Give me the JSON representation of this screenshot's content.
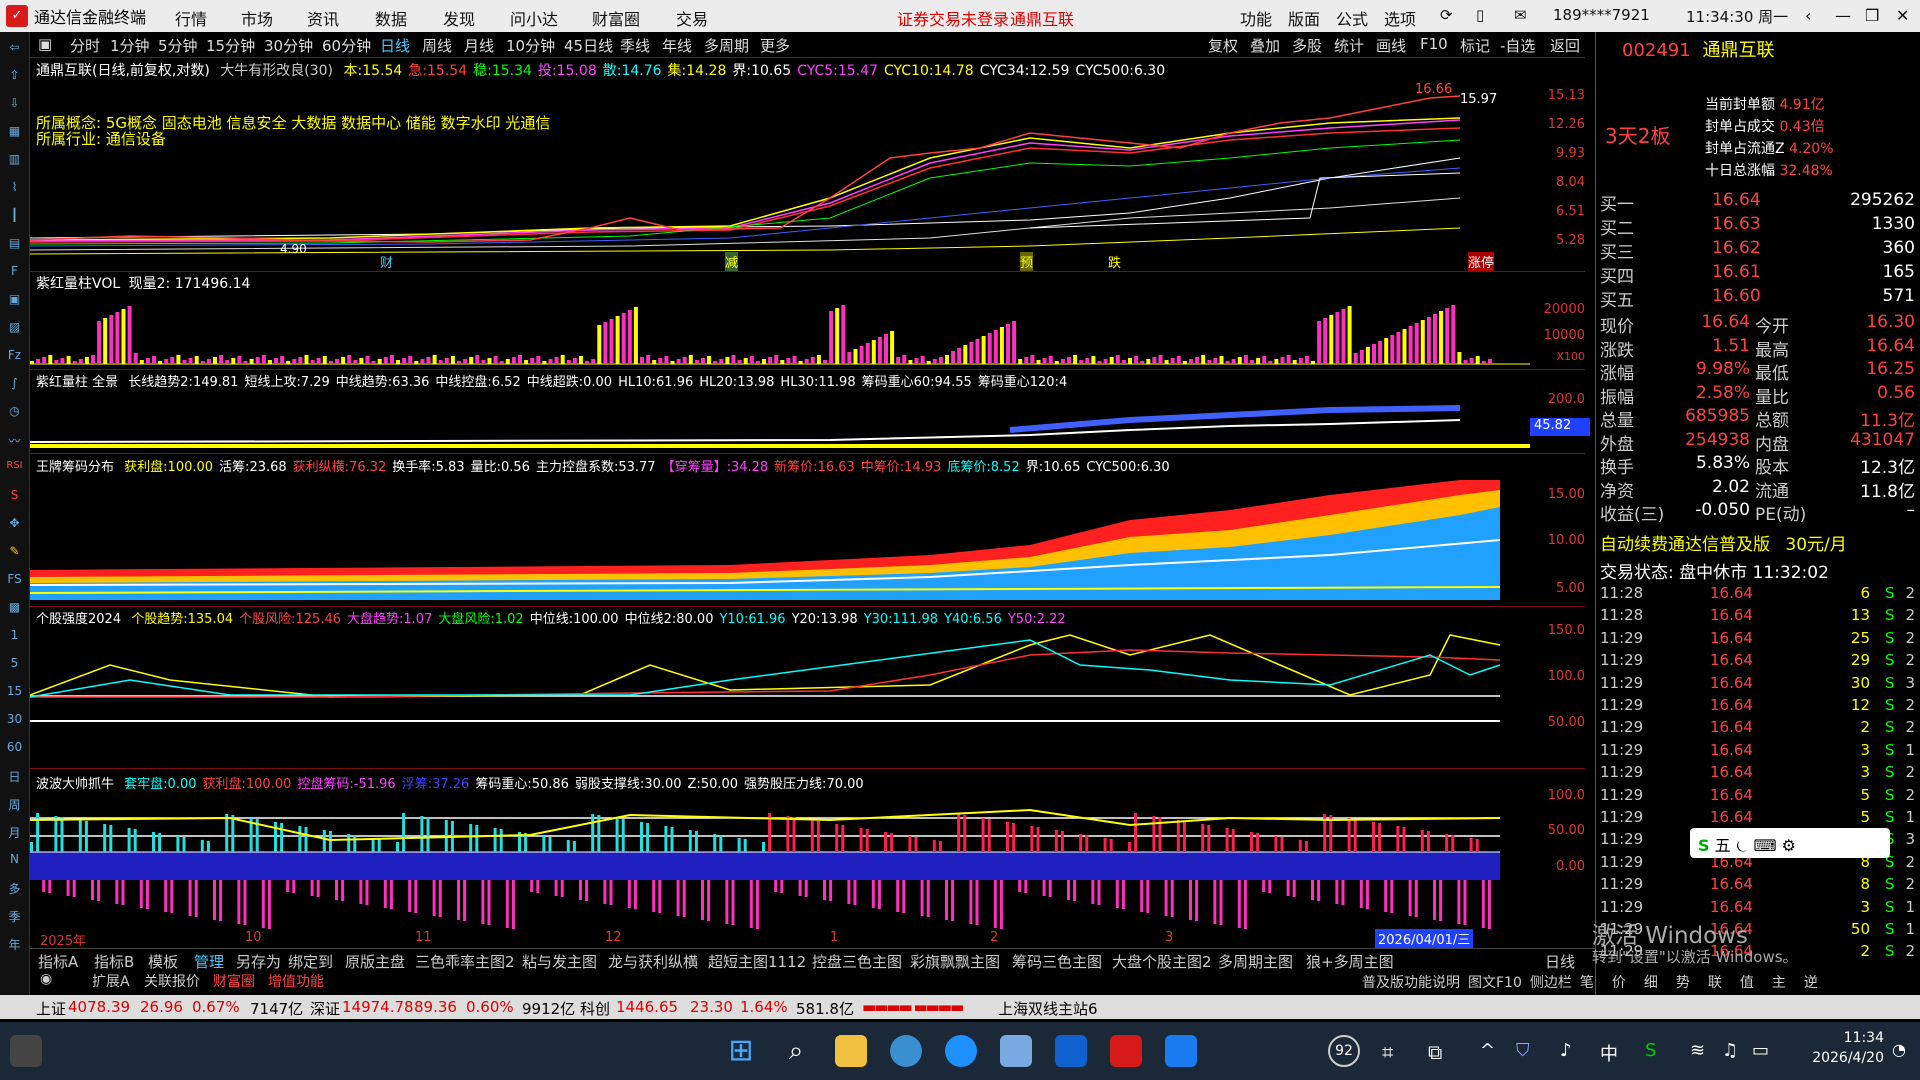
{
  "titlebar": {
    "app_name": "通达信金融终端",
    "menus": [
      "行情",
      "市场",
      "资讯",
      "数据",
      "发现",
      "问小达",
      "财富圈",
      "交易"
    ],
    "alert": "证券交易未登录",
    "stock_name": "通鼎互联",
    "right_menus": [
      "功能",
      "版面",
      "公式",
      "选项"
    ],
    "account": "189****7921",
    "clock": "11:34:30 周一"
  },
  "period_toolbar": {
    "items": [
      "分时",
      "1分钟",
      "5分钟",
      "15分钟",
      "30分钟",
      "60分钟",
      "日线",
      "周线",
      "月线",
      "10分钟",
      "45日线",
      "季线",
      "年线",
      "多周期",
      "更多"
    ],
    "right": [
      "复权",
      "叠加",
      "多股",
      "统计",
      "画线",
      "F10",
      "标记",
      "-自选",
      "返回"
    ]
  },
  "main_chart": {
    "header": "通鼎互联(日线,前复权,对数)",
    "indicator": "大牛有形改良(30)",
    "params": [
      {
        "k": "本:",
        "v": "15.54",
        "c": "#ffff00"
      },
      {
        "k": "急:",
        "v": "15.54",
        "c": "#ff4040"
      },
      {
        "k": "稳:",
        "v": "15.34",
        "c": "#00ff00"
      },
      {
        "k": "投:",
        "v": "15.08",
        "c": "#ff40ff"
      },
      {
        "k": "散:",
        "v": "14.76",
        "c": "#00ffff"
      },
      {
        "k": "集:",
        "v": "14.28",
        "c": "#ffff00"
      },
      {
        "k": "界:",
        "v": "10.65",
        "c": "#fff"
      },
      {
        "k": "CYC5:",
        "v": "15.47",
        "c": "#ff40ff"
      },
      {
        "k": "CYC10:",
        "v": "14.78",
        "c": "#ffff00"
      },
      {
        "k": "CYC34:",
        "v": "12.59",
        "c": "#fff"
      },
      {
        "k": "CYC500:",
        "v": "6.30",
        "c": "#fff"
      }
    ],
    "concept_label": "所属概念:",
    "concepts": "5G概念 固态电池 信息安全 大数据 数据中心 储能 数字水印 光通信",
    "industry_label": "所属行业:",
    "industry": "通信设备",
    "high_label": "16.66",
    "close_label": "15.97",
    "low_label": "4.90",
    "markers": [
      "财",
      "减",
      "预",
      "跌",
      "涨停"
    ],
    "y_ticks": [
      "15.13",
      "12.26",
      "9.93",
      "8.04",
      "6.51",
      "5.28"
    ]
  },
  "vol_panel": {
    "title": "紫红量柱VOL",
    "now_label": "现量2:",
    "now_value": "171496.14",
    "y_ticks": [
      "20000",
      "10000",
      "X100"
    ]
  },
  "trend_panel": {
    "title": "紫红量柱 全景",
    "items": [
      {
        "k": "长线趋势2:",
        "v": "149.81"
      },
      {
        "k": "短线上攻:",
        "v": "7.29"
      },
      {
        "k": "中线趋势:",
        "v": "63.36"
      },
      {
        "k": "中线控盘:",
        "v": "6.52"
      },
      {
        "k": "中线超跌:",
        "v": "0.00"
      },
      {
        "k": "HL10:",
        "v": "61.96"
      },
      {
        "k": "HL20:",
        "v": "13.98"
      },
      {
        "k": "HL30:",
        "v": "11.98"
      },
      {
        "k": "筹码重心60:",
        "v": "94.55"
      },
      {
        "k": "筹码重心120:",
        "v": "4"
      }
    ],
    "y_tick": "200.0",
    "current": "45.82"
  },
  "chip_panel": {
    "title": "王牌筹码分布",
    "items": [
      {
        "k": "获利盘:",
        "v": "100.00",
        "c": "#ffff00"
      },
      {
        "k": "活筹:",
        "v": "23.68",
        "c": "#fff"
      },
      {
        "k": "获利纵横:",
        "v": "76.32",
        "c": "#ff4040"
      },
      {
        "k": "换手率:",
        "v": "5.83",
        "c": "#fff"
      },
      {
        "k": "量比:",
        "v": "0.56",
        "c": "#fff"
      },
      {
        "k": "主力控盘系数:",
        "v": "53.77",
        "c": "#fff"
      },
      {
        "k": "【穿筹量】:",
        "v": "34.28",
        "c": "#ff40ff"
      },
      {
        "k": "新筹价:",
        "v": "16.63",
        "c": "#ff4040"
      },
      {
        "k": "中筹价:",
        "v": "14.93",
        "c": "#ff4040"
      },
      {
        "k": "底筹价:",
        "v": "8.52",
        "c": "#00ffff"
      },
      {
        "k": "界:",
        "v": "10.65",
        "c": "#fff"
      },
      {
        "k": "CYC500:",
        "v": "6.30",
        "c": "#fff"
      }
    ],
    "y_ticks": [
      "15.00",
      "10.00",
      "5.00"
    ]
  },
  "strength_panel": {
    "title": "个股强度2024",
    "items": [
      {
        "k": "个股趋势:",
        "v": "135.04",
        "c": "#ffff00"
      },
      {
        "k": "个股风险:",
        "v": "125.46",
        "c": "#ff4040"
      },
      {
        "k": "大盘趋势:",
        "v": "1.07",
        "c": "#ff40ff"
      },
      {
        "k": "大盘风险:",
        "v": "1.02",
        "c": "#00ff00"
      },
      {
        "k": "中位线:",
        "v": "100.00",
        "c": "#fff"
      },
      {
        "k": "中位线2:",
        "v": "80.00",
        "c": "#fff"
      },
      {
        "k": "Y10:",
        "v": "61.96",
        "c": "#00ffff"
      },
      {
        "k": "Y20:",
        "v": "13.98",
        "c": "#fff"
      },
      {
        "k": "Y30:",
        "v": "111.98",
        "c": "#00ffff"
      },
      {
        "k": "Y40:",
        "v": "6.56",
        "c": "#00ffff"
      },
      {
        "k": "Y50:",
        "v": "2.22",
        "c": "#ff40ff"
      }
    ],
    "y_ticks": [
      "150.0",
      "100.0",
      "50.00"
    ]
  },
  "wave_panel": {
    "title": "波波大帅抓牛",
    "items": [
      {
        "k": "套牢盘:",
        "v": "0.00",
        "c": "#00ffff"
      },
      {
        "k": "获利盘:",
        "v": "100.00",
        "c": "#ff4040"
      },
      {
        "k": "控盘筹码:",
        "v": "-51.96",
        "c": "#ff40ff"
      },
      {
        "k": "浮筹:",
        "v": "37.26",
        "c": "#4040ff"
      },
      {
        "k": "筹码重心:",
        "v": "50.86",
        "c": "#fff"
      },
      {
        "k": "弱股支撑线:",
        "v": "30.00",
        "c": "#fff"
      },
      {
        "k": "Z:",
        "v": "50.00",
        "c": "#fff"
      },
      {
        "k": "强势股压力线:",
        "v": "70.00",
        "c": "#fff"
      }
    ],
    "y_ticks": [
      "100.0",
      "50.00",
      "0.00"
    ],
    "date_start": "2025年",
    "date_cursor": "2026/04/01/三",
    "x_ticks": [
      "10",
      "11",
      "12",
      "1",
      "2",
      "3"
    ]
  },
  "bottom_tabs": [
    "指标A",
    "指标B",
    "模板",
    "管理",
    "另存为",
    "绑定到",
    "原版主盘",
    "三色乖率主图2",
    "粘与发主图",
    "龙与获利纵横",
    "超短主图1112",
    "控盘三色主图",
    "彩旗飘飘主图",
    "筹码三色主图",
    "大盘个股主图2",
    "多周期主图",
    "狼+多周主图"
  ],
  "bottom_tabs2": [
    "扩展A",
    "关联报价",
    "财富圈",
    "增值功能"
  ],
  "period_label": "日线",
  "right_panel": {
    "code": "002491",
    "name": "通鼎互联",
    "limit_tag": "3天2板",
    "seal": [
      {
        "k": "当前封单额",
        "v": "4.91亿"
      },
      {
        "k": "封单占成交",
        "v": "0.43倍"
      },
      {
        "k": "封单占流通Z",
        "v": "4.20%"
      },
      {
        "k": "十日总涨幅",
        "v": "32.48%"
      }
    ],
    "bids": [
      {
        "k": "买一",
        "p": "16.64",
        "v": "295262"
      },
      {
        "k": "买二",
        "p": "16.63",
        "v": "1330"
      },
      {
        "k": "买三",
        "p": "16.62",
        "v": "360"
      },
      {
        "k": "买四",
        "p": "16.61",
        "v": "165"
      },
      {
        "k": "买五",
        "p": "16.60",
        "v": "571"
      }
    ],
    "quotes": [
      {
        "a": "现价",
        "av": "16.64",
        "b": "今开",
        "bv": "16.30"
      },
      {
        "a": "涨跌",
        "av": "1.51",
        "b": "最高",
        "bv": "16.64"
      },
      {
        "a": "涨幅",
        "av": "9.98%",
        "b": "最低",
        "bv": "16.25"
      },
      {
        "a": "振幅",
        "av": "2.58%",
        "b": "量比",
        "bv": "0.56"
      },
      {
        "a": "总量",
        "av": "685985",
        "b": "总额",
        "bv": "11.3亿"
      },
      {
        "a": "外盘",
        "av": "254938",
        "b": "内盘",
        "bv": "431047"
      },
      {
        "a": "换手",
        "av": "5.83%",
        "b": "股本",
        "bv": "12.3亿"
      },
      {
        "a": "净资",
        "av": "2.02",
        "b": "流通",
        "bv": "11.8亿"
      },
      {
        "a": "收益(三)",
        "av": "-0.050",
        "b": "PE(动)",
        "bv": "–"
      }
    ],
    "ad": "自动续费通达信普及版",
    "ad_price": "30元/月",
    "trade_state": "交易状态: 盘中休市 11:32:02",
    "ticks": [
      {
        "t": "11:28",
        "p": "16.64",
        "v": "6",
        "s": "S",
        "n": "2"
      },
      {
        "t": "11:28",
        "p": "16.64",
        "v": "13",
        "s": "S",
        "n": "2"
      },
      {
        "t": "11:29",
        "p": "16.64",
        "v": "25",
        "s": "S",
        "n": "2"
      },
      {
        "t": "11:29",
        "p": "16.64",
        "v": "29",
        "s": "S",
        "n": "2"
      },
      {
        "t": "11:29",
        "p": "16.64",
        "v": "30",
        "s": "S",
        "n": "3"
      },
      {
        "t": "11:29",
        "p": "16.64",
        "v": "12",
        "s": "S",
        "n": "2"
      },
      {
        "t": "11:29",
        "p": "16.64",
        "v": "2",
        "s": "S",
        "n": "2"
      },
      {
        "t": "11:29",
        "p": "16.64",
        "v": "3",
        "s": "S",
        "n": "1"
      },
      {
        "t": "11:29",
        "p": "16.64",
        "v": "3",
        "s": "S",
        "n": "2"
      },
      {
        "t": "11:29",
        "p": "16.64",
        "v": "5",
        "s": "S",
        "n": "2"
      },
      {
        "t": "11:29",
        "p": "16.64",
        "v": "5",
        "s": "S",
        "n": "1"
      },
      {
        "t": "11:29",
        "p": "16.64",
        "v": "3",
        "s": "S",
        "n": "3"
      },
      {
        "t": "11:29",
        "p": "16.64",
        "v": "8",
        "s": "S",
        "n": "2"
      },
      {
        "t": "11:29",
        "p": "16.64",
        "v": "8",
        "s": "S",
        "n": "2"
      },
      {
        "t": "11:29",
        "p": "16.64",
        "v": "3",
        "s": "S",
        "n": "1"
      },
      {
        "t": "11:29",
        "p": "16.64",
        "v": "50",
        "s": "S",
        "n": "1"
      },
      {
        "t": "11:29",
        "p": "16.64",
        "v": "2",
        "s": "S",
        "n": "2"
      }
    ],
    "ime_label": "五",
    "activate_windows": "激活 Windows",
    "activate_hint": "转到\"设置\"以激活 Windows。",
    "bottom_links": [
      "普及版功能说明",
      "图文F10",
      "侧边栏",
      "笔",
      "价",
      "细",
      "势",
      "联",
      "值",
      "主",
      "逆"
    ]
  },
  "statusbar": {
    "sh_label": "上证",
    "sh": "4078.39",
    "sh_chg": "26.96",
    "sh_pct": "0.67%",
    "sh_amt": "7147亿",
    "sz_label": "深证",
    "sz": "14974.78",
    "sz_chg": "89.36",
    "sz_pct": "0.60%",
    "sz_amt": "9912亿",
    "kc_label": "科创",
    "kc": "1446.65",
    "kc_chg": "23.30",
    "kc_pct": "1.64%",
    "kc_amt": "581.8亿",
    "server": "上海双线主站6"
  },
  "taskbar": {
    "badge": "92",
    "time": "11:34",
    "date": "2026/4/20"
  },
  "colors": {
    "up": "#ff4040",
    "down": "#00ff00",
    "accent": "#ffff00"
  }
}
